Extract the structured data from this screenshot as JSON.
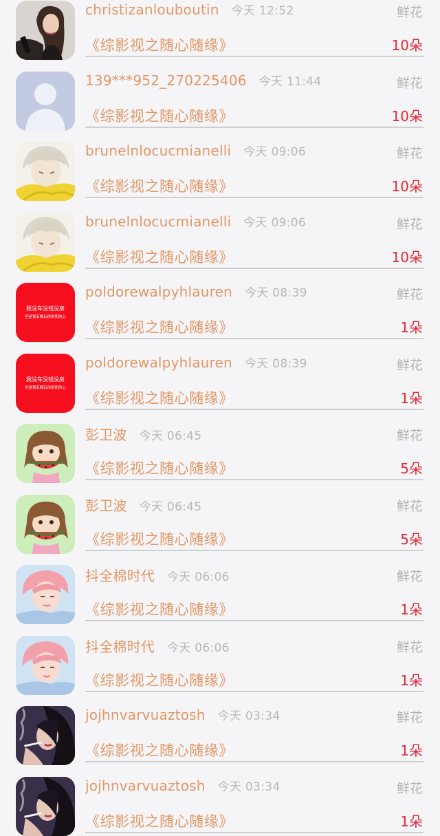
{
  "items": [
    {
      "name": "christizanlouboutin",
      "time": "今天 12:52",
      "gift": "鲜花",
      "book": "《综影视之随心随缘》",
      "count": "10朵",
      "avatar": "woman-photo-avatar"
    },
    {
      "name": "139***952_270225406",
      "time": "今天 11:44",
      "gift": "鲜花",
      "book": "《综影视之随心随缘》",
      "count": "10朵",
      "avatar": "default-user-avatar"
    },
    {
      "name": "brunelnlocucmianelli",
      "time": "今天 09:06",
      "gift": "鲜花",
      "book": "《综影视之随心随缘》",
      "count": "10朵",
      "avatar": "anime-boy-avatar"
    },
    {
      "name": "brunelnlocucmianelli",
      "time": "今天 09:06",
      "gift": "鲜花",
      "book": "《综影视之随心随缘》",
      "count": "10朵",
      "avatar": "anime-boy-avatar"
    },
    {
      "name": "poldorewalpyhlauren",
      "time": "今天 08:39",
      "gift": "鲜花",
      "book": "《综影视之随心随缘》",
      "count": "1朵",
      "avatar": "red-text-avatar"
    },
    {
      "name": "poldorewalpyhlauren",
      "time": "今天 08:39",
      "gift": "鲜花",
      "book": "《综影视之随心随缘》",
      "count": "1朵",
      "avatar": "red-text-avatar"
    },
    {
      "name": "彭卫波",
      "time": "今天 06:45",
      "gift": "鲜花",
      "book": "《综影视之随心随缘》",
      "count": "5朵",
      "avatar": "cartoon-girl-watermelon-avatar"
    },
    {
      "name": "彭卫波",
      "time": "今天 06:45",
      "gift": "鲜花",
      "book": "《综影视之随心随缘》",
      "count": "5朵",
      "avatar": "cartoon-girl-watermelon-avatar"
    },
    {
      "name": "抖全棉时代",
      "time": "今天 06:06",
      "gift": "鲜花",
      "book": "《综影视之随心随缘》",
      "count": "1朵",
      "avatar": "pink-hair-boy-avatar"
    },
    {
      "name": "抖全棉时代",
      "time": "今天 06:06",
      "gift": "鲜花",
      "book": "《综影视之随心随缘》",
      "count": "1朵",
      "avatar": "pink-hair-boy-avatar"
    },
    {
      "name": "jojhnvarvuaztosh",
      "time": "今天 03:34",
      "gift": "鲜花",
      "book": "《综影视之随心随缘》",
      "count": "1朵",
      "avatar": "smoking-woman-avatar"
    },
    {
      "name": "jojhnvarvuaztosh",
      "time": "今天 03:34",
      "gift": "鲜花",
      "book": "《综影视之随心随缘》",
      "count": "1朵",
      "avatar": "smoking-woman-avatar"
    }
  ],
  "red_avatar_text": {
    "line1": "我没车没钱没房",
    "line2": "但是我有颗玩你到死的心"
  },
  "colors": {
    "name": "#e39664",
    "time": "#b8b8b8",
    "gift": "#b3b3b3",
    "count": "#e22835",
    "divider": "#cfcfcf",
    "background": "#f5f5f7"
  }
}
